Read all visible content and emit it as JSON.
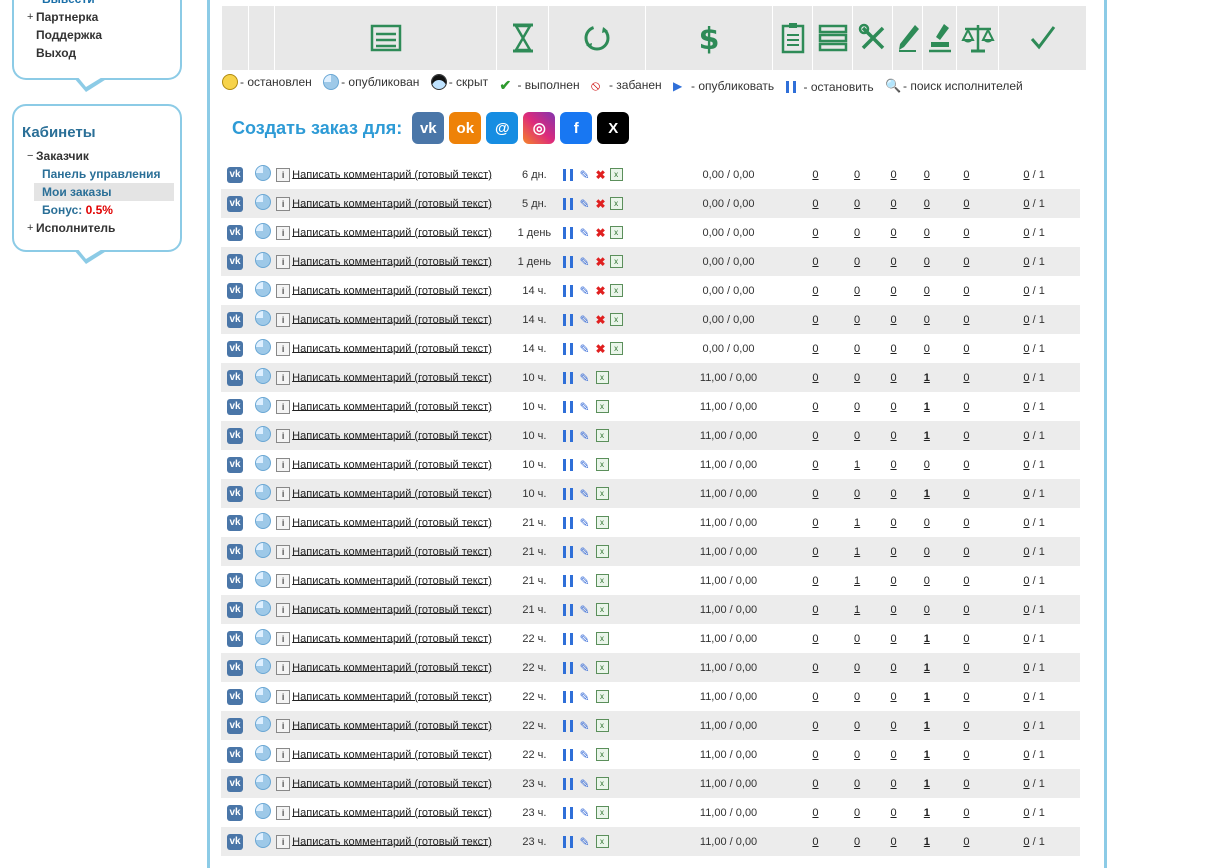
{
  "sidebar": {
    "top_menu": [
      {
        "label": "Вывести",
        "prefix": ""
      },
      {
        "label": "Партнерка",
        "prefix": "+"
      },
      {
        "label": "Поддержка",
        "prefix": ""
      },
      {
        "label": "Выход",
        "prefix": ""
      }
    ],
    "cabinets_title": "Кабинеты",
    "customer": {
      "label": "Заказчик",
      "prefix": "−"
    },
    "customer_items": [
      "Панель управления",
      "Мои заказы"
    ],
    "bonus_label": "Бонус:",
    "bonus_value": "0.5%",
    "executor": {
      "label": "Исполнитель",
      "prefix": "+"
    }
  },
  "legend": {
    "stopped": "- остановлен",
    "published": "- опубликован",
    "hidden": "- скрыт",
    "done": "- выполнен",
    "banned": "- забанен",
    "publish": "- опубликовать",
    "stop": "- остановить",
    "search": "- поиск исполнителей"
  },
  "create": {
    "label": "Создать заказ для:",
    "networks": [
      {
        "icon": "vk-icon",
        "text": "vk",
        "color": "#4a76a8"
      },
      {
        "icon": "odnoklassniki-icon",
        "text": "ok",
        "color": "#ee8208"
      },
      {
        "icon": "mailru-icon",
        "text": "@",
        "color": "#168de2"
      },
      {
        "icon": "instagram-icon",
        "text": "◎",
        "color": "#d62976"
      },
      {
        "icon": "facebook-icon",
        "text": "f",
        "color": "#1877f2"
      },
      {
        "icon": "x-twitter-icon",
        "text": "X",
        "color": "#000000"
      }
    ]
  },
  "orders": [
    {
      "title": "Написать комментарий (готовый текст)",
      "time": "6 дн.",
      "price": "0,00 / 0,00",
      "n1": "0",
      "n2": "0",
      "n3": "0",
      "n4": "0",
      "n5": "0",
      "last": "0",
      "total": "/ 1",
      "deletable": true
    },
    {
      "title": "Написать комментарий (готовый текст)",
      "time": "5 дн.",
      "price": "0,00 / 0,00",
      "n1": "0",
      "n2": "0",
      "n3": "0",
      "n4": "0",
      "n5": "0",
      "last": "0",
      "total": "/ 1",
      "deletable": true
    },
    {
      "title": "Написать комментарий (готовый текст)",
      "time": "1 день",
      "price": "0,00 / 0,00",
      "n1": "0",
      "n2": "0",
      "n3": "0",
      "n4": "0",
      "n5": "0",
      "last": "0",
      "total": "/ 1",
      "deletable": true
    },
    {
      "title": "Написать комментарий (готовый текст)",
      "time": "1 день",
      "price": "0,00 / 0,00",
      "n1": "0",
      "n2": "0",
      "n3": "0",
      "n4": "0",
      "n5": "0",
      "last": "0",
      "total": "/ 1",
      "deletable": true
    },
    {
      "title": "Написать комментарий (готовый текст)",
      "time": "14 ч.",
      "price": "0,00 / 0,00",
      "n1": "0",
      "n2": "0",
      "n3": "0",
      "n4": "0",
      "n5": "0",
      "last": "0",
      "total": "/ 1",
      "deletable": true
    },
    {
      "title": "Написать комментарий (готовый текст)",
      "time": "14 ч.",
      "price": "0,00 / 0,00",
      "n1": "0",
      "n2": "0",
      "n3": "0",
      "n4": "0",
      "n5": "0",
      "last": "0",
      "total": "/ 1",
      "deletable": true
    },
    {
      "title": "Написать комментарий (готовый текст)",
      "time": "14 ч.",
      "price": "0,00 / 0,00",
      "n1": "0",
      "n2": "0",
      "n3": "0",
      "n4": "0",
      "n5": "0",
      "last": "0",
      "total": "/ 1",
      "deletable": true
    },
    {
      "title": "Написать комментарий (готовый текст)",
      "time": "10 ч.",
      "price": "11,00 / 0,00",
      "n1": "0",
      "n2": "0",
      "n3": "0",
      "n4": "1",
      "n5": "0",
      "last": "0",
      "total": "/ 1",
      "deletable": false
    },
    {
      "title": "Написать комментарий (готовый текст)",
      "time": "10 ч.",
      "price": "11,00 / 0,00",
      "n1": "0",
      "n2": "0",
      "n3": "0",
      "n4": "1",
      "n5": "0",
      "last": "0",
      "total": "/ 1",
      "deletable": false
    },
    {
      "title": "Написать комментарий (готовый текст)",
      "time": "10 ч.",
      "price": "11,00 / 0,00",
      "n1": "0",
      "n2": "0",
      "n3": "0",
      "n4": "1",
      "n5": "0",
      "last": "0",
      "total": "/ 1",
      "deletable": false
    },
    {
      "title": "Написать комментарий (готовый текст)",
      "time": "10 ч.",
      "price": "11,00 / 0,00",
      "n1": "0",
      "n2": "1",
      "n3": "0",
      "n4": "0",
      "n5": "0",
      "last": "0",
      "total": "/ 1",
      "deletable": false
    },
    {
      "title": "Написать комментарий (готовый текст)",
      "time": "10 ч.",
      "price": "11,00 / 0,00",
      "n1": "0",
      "n2": "0",
      "n3": "0",
      "n4": "1",
      "n5": "0",
      "last": "0",
      "total": "/ 1",
      "deletable": false
    },
    {
      "title": "Написать комментарий (готовый текст)",
      "time": "21 ч.",
      "price": "11,00 / 0,00",
      "n1": "0",
      "n2": "1",
      "n3": "0",
      "n4": "0",
      "n5": "0",
      "last": "0",
      "total": "/ 1",
      "deletable": false
    },
    {
      "title": "Написать комментарий (готовый текст)",
      "time": "21 ч.",
      "price": "11,00 / 0,00",
      "n1": "0",
      "n2": "1",
      "n3": "0",
      "n4": "0",
      "n5": "0",
      "last": "0",
      "total": "/ 1",
      "deletable": false
    },
    {
      "title": "Написать комментарий (готовый текст)",
      "time": "21 ч.",
      "price": "11,00 / 0,00",
      "n1": "0",
      "n2": "1",
      "n3": "0",
      "n4": "0",
      "n5": "0",
      "last": "0",
      "total": "/ 1",
      "deletable": false
    },
    {
      "title": "Написать комментарий (готовый текст)",
      "time": "21 ч.",
      "price": "11,00 / 0,00",
      "n1": "0",
      "n2": "1",
      "n3": "0",
      "n4": "0",
      "n5": "0",
      "last": "0",
      "total": "/ 1",
      "deletable": false
    },
    {
      "title": "Написать комментарий (готовый текст)",
      "time": "22 ч.",
      "price": "11,00 / 0,00",
      "n1": "0",
      "n2": "0",
      "n3": "0",
      "n4": "1",
      "n5": "0",
      "last": "0",
      "total": "/ 1",
      "deletable": false
    },
    {
      "title": "Написать комментарий (готовый текст)",
      "time": "22 ч.",
      "price": "11,00 / 0,00",
      "n1": "0",
      "n2": "0",
      "n3": "0",
      "n4": "1",
      "n5": "0",
      "last": "0",
      "total": "/ 1",
      "deletable": false
    },
    {
      "title": "Написать комментарий (готовый текст)",
      "time": "22 ч.",
      "price": "11,00 / 0,00",
      "n1": "0",
      "n2": "0",
      "n3": "0",
      "n4": "1",
      "n5": "0",
      "last": "0",
      "total": "/ 1",
      "deletable": false
    },
    {
      "title": "Написать комментарий (готовый текст)",
      "time": "22 ч.",
      "price": "11,00 / 0,00",
      "n1": "0",
      "n2": "0",
      "n3": "0",
      "n4": "1",
      "n5": "0",
      "last": "0",
      "total": "/ 1",
      "deletable": false
    },
    {
      "title": "Написать комментарий (готовый текст)",
      "time": "22 ч.",
      "price": "11,00 / 0,00",
      "n1": "0",
      "n2": "0",
      "n3": "0",
      "n4": "1",
      "n5": "0",
      "last": "0",
      "total": "/ 1",
      "deletable": false
    },
    {
      "title": "Написать комментарий (готовый текст)",
      "time": "23 ч.",
      "price": "11,00 / 0,00",
      "n1": "0",
      "n2": "0",
      "n3": "0",
      "n4": "1",
      "n5": "0",
      "last": "0",
      "total": "/ 1",
      "deletable": false
    },
    {
      "title": "Написать комментарий (готовый текст)",
      "time": "23 ч.",
      "price": "11,00 / 0,00",
      "n1": "0",
      "n2": "0",
      "n3": "0",
      "n4": "1",
      "n5": "0",
      "last": "0",
      "total": "/ 1",
      "deletable": false
    },
    {
      "title": "Написать комментарий (готовый текст)",
      "time": "23 ч.",
      "price": "11,00 / 0,00",
      "n1": "0",
      "n2": "0",
      "n3": "0",
      "n4": "1",
      "n5": "0",
      "last": "0",
      "total": "/ 1",
      "deletable": false
    }
  ]
}
